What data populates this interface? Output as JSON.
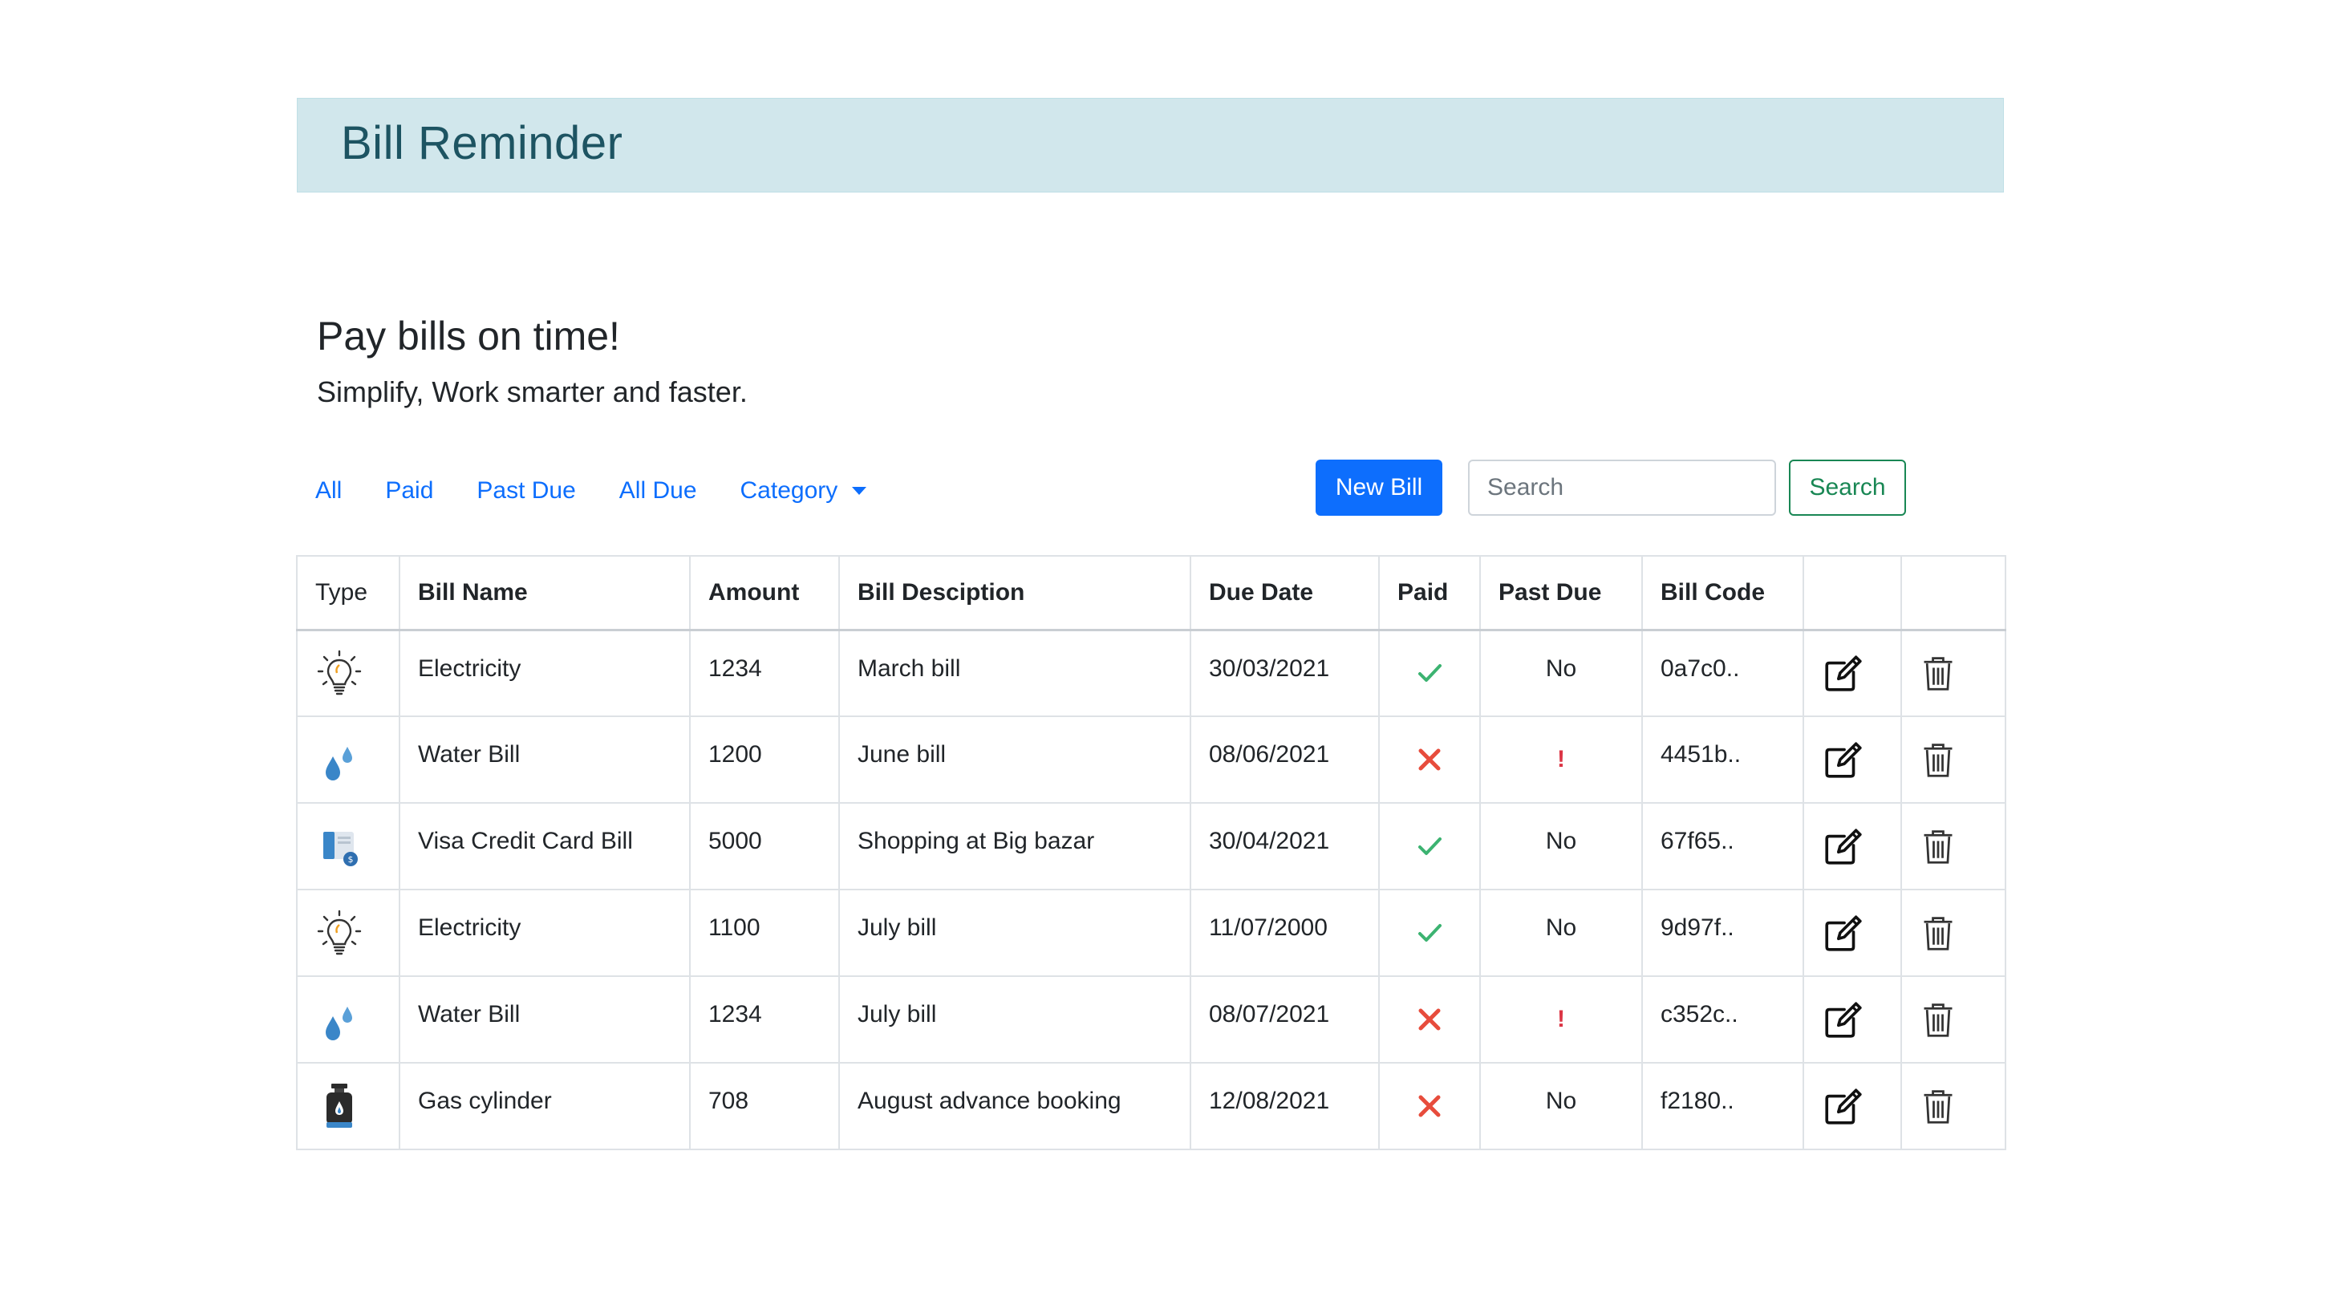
{
  "header": {
    "title": "Bill Reminder"
  },
  "hero": {
    "title": "Pay bills on time!",
    "subtitle": "Simplify, Work smarter and faster."
  },
  "nav": {
    "all": "All",
    "paid": "Paid",
    "past_due": "Past Due",
    "all_due": "All Due",
    "category": "Category"
  },
  "toolbar": {
    "new_bill": "New Bill",
    "search_placeholder": "Search",
    "search_button": "Search"
  },
  "table": {
    "headers": {
      "type": "Type",
      "bill_name": "Bill Name",
      "amount": "Amount",
      "description": "Bill Desciption",
      "due_date": "Due Date",
      "paid": "Paid",
      "past_due": "Past Due",
      "bill_code": "Bill Code"
    },
    "rows": [
      {
        "type_icon": "lightbulb-icon",
        "name": "Electricity",
        "amount": "1234",
        "description": "March bill",
        "due_date": "30/03/2021",
        "paid": true,
        "past_due": "No",
        "code": "0a7c0.."
      },
      {
        "type_icon": "water-drop-icon",
        "name": "Water Bill",
        "amount": "1200",
        "description": "June bill",
        "due_date": "08/06/2021",
        "paid": false,
        "past_due": "!",
        "code": "4451b.."
      },
      {
        "type_icon": "credit-card-icon",
        "name": "Visa Credit Card Bill",
        "amount": "5000",
        "description": "Shopping at Big bazar",
        "due_date": "30/04/2021",
        "paid": true,
        "past_due": "No",
        "code": "67f65.."
      },
      {
        "type_icon": "lightbulb-icon",
        "name": "Electricity",
        "amount": "1100",
        "description": "July bill",
        "due_date": "11/07/2000",
        "paid": true,
        "past_due": "No",
        "code": "9d97f.."
      },
      {
        "type_icon": "water-drop-icon",
        "name": "Water Bill",
        "amount": "1234",
        "description": "July bill",
        "due_date": "08/07/2021",
        "paid": false,
        "past_due": "!",
        "code": "c352c.."
      },
      {
        "type_icon": "gas-cylinder-icon",
        "name": "Gas cylinder",
        "amount": "708",
        "description": "August advance booking",
        "due_date": "12/08/2021",
        "paid": false,
        "past_due": "No",
        "code": "f2180.."
      }
    ]
  },
  "colors": {
    "banner_bg": "#d1e7ec",
    "banner_text": "#1d5462",
    "link": "#0d6efd",
    "primary": "#0d6efd",
    "success": "#198754",
    "check": "#3cb371",
    "cross": "#e74c3c",
    "danger": "#dc3545"
  }
}
